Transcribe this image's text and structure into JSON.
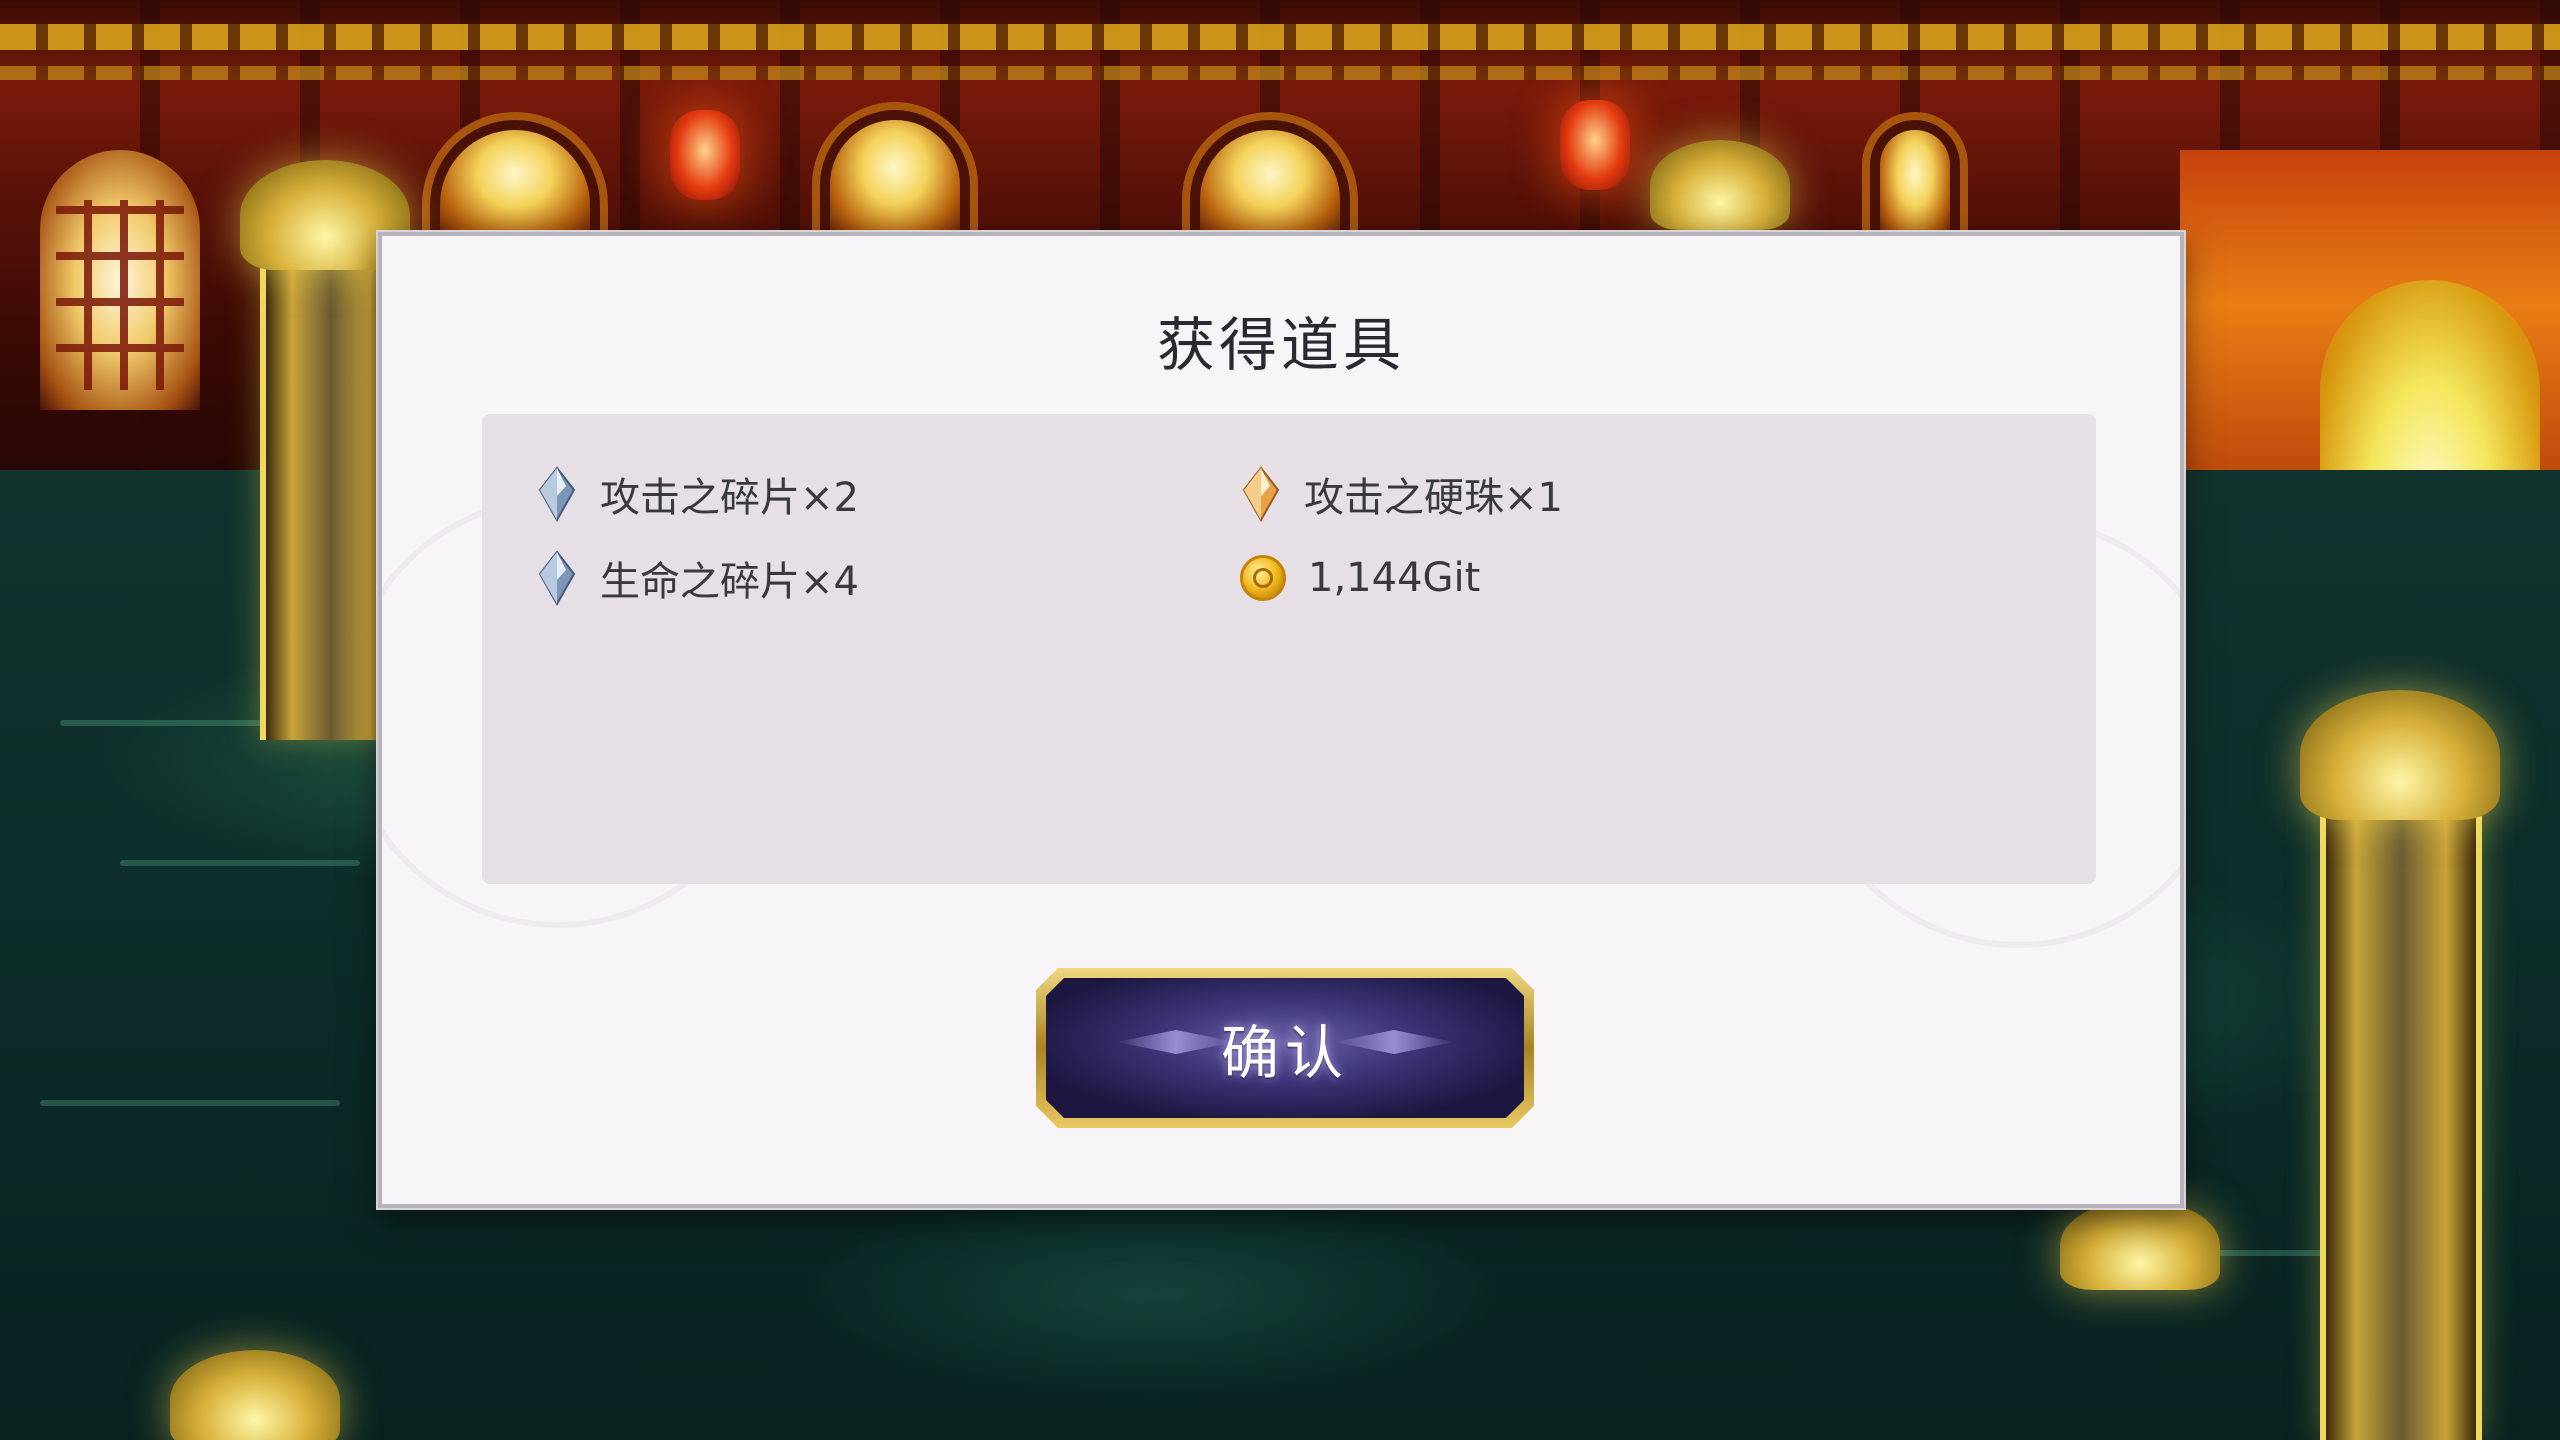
{
  "dialog": {
    "title": "获得道具",
    "items": [
      {
        "label": "攻击之碎片×2",
        "icon": "blue-crystal-shard-icon"
      },
      {
        "label": "攻击之硬珠×1",
        "icon": "gold-crystal-icon"
      },
      {
        "label": "生命之碎片×4",
        "icon": "blue-crystal-shard-icon"
      },
      {
        "label": "1,144Git",
        "icon": "gold-coin-icon"
      }
    ],
    "confirm_label": "确认"
  },
  "colors": {
    "dialog_bg": "#f8f5f8",
    "panel_bg": "#e6e0e6",
    "button_purple": "#3e367a",
    "button_gold_frame": "#d8b24a"
  }
}
